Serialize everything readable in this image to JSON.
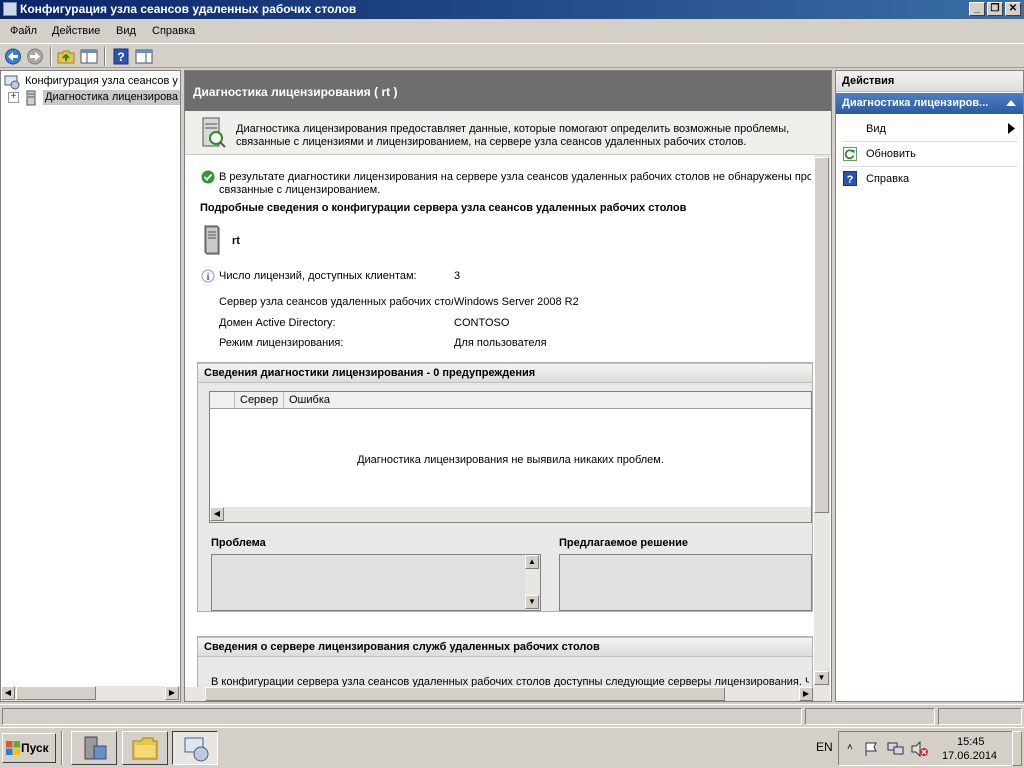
{
  "window": {
    "title": "Конфигурация узла сеансов удаленных рабочих столов",
    "min_glyph": "_",
    "max_glyph": "❐",
    "close_glyph": "✕"
  },
  "menu": [
    "Файл",
    "Действие",
    "Вид",
    "Справка"
  ],
  "toolbar_icons": [
    "back-icon",
    "forward-icon",
    "up-folder-icon",
    "show-hide-tree-icon",
    "help-icon",
    "show-hide-action-pane-icon"
  ],
  "tree": {
    "root": "Конфигурация узла сеансов у",
    "child": "Диагностика лицензирова",
    "expander": "+"
  },
  "center": {
    "header": "Диагностика лицензирования ( rt )",
    "description_line1": "Диагностика лицензирования предоставляет данные, которые помогают определить возможные проблемы,",
    "description_line2": "связанные с лицензиями и лицензированием, на сервере узла сеансов удаленных рабочих столов.",
    "result_line1": "В результате диагностики лицензирования на сервере узла сеансов удаленных рабочих столов не обнаружены проб",
    "result_line2": "связанные с лицензированием.",
    "details_title": "Подробные сведения о конфигурации сервера узла сеансов удаленных рабочих столов",
    "server_name": "rt",
    "fields": [
      {
        "label": "Число лицензий, доступных клиентам:",
        "value": "3"
      },
      {
        "label": "Сервер узла сеансов удаленных рабочих стол",
        "value": "Windows Server 2008 R2"
      },
      {
        "label": "Домен Active Directory:",
        "value": "CONTOSO"
      },
      {
        "label": "Режим лицензирования:",
        "value": "Для пользователя"
      }
    ],
    "diag_section": "Сведения диагностики лицензирования - 0 предупреждения",
    "table_headers": [
      "Сервер",
      "Ошибка"
    ],
    "table_empty": "Диагностика лицензирования не выявила никаких проблем.",
    "problem_label": "Проблема",
    "solution_label": "Предлагаемое решение",
    "license_server_section": "Сведения о сервере лицензирования служб удаленных рабочих столов",
    "license_server_text": "В конфигурации сервера узла сеансов удаленных рабочих столов доступны следующие серверы лицензирования. Чт"
  },
  "actions": {
    "title": "Действия",
    "subtitle": "Диагностика лицензиров...",
    "items": [
      "Вид",
      "Обновить",
      "Справка"
    ]
  },
  "taskbar": {
    "start": "Пуск",
    "lang": "EN",
    "time": "15:45",
    "date": "17.06.2014"
  },
  "colors": {
    "header_gray": "#6e6e6e",
    "selection_blue": "#2c5aa0",
    "ok_green": "#2e9a2e"
  }
}
